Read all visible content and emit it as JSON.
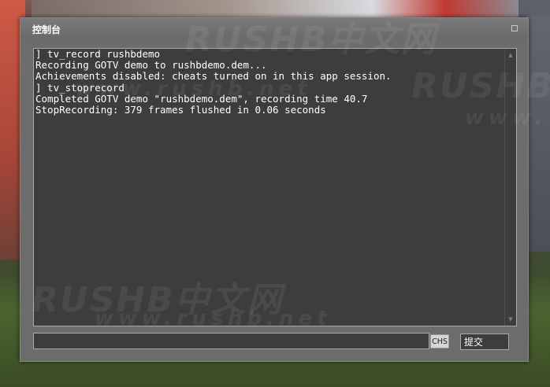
{
  "window": {
    "title": "控制台"
  },
  "console": {
    "lines": [
      "] tv_record rushbdemo",
      "Recording GOTV demo to rushbdemo.dem...",
      "Achievements disabled: cheats turned on in this app session.",
      "] tv_stoprecord",
      "Completed GOTV demo \"rushbdemo.dem\", recording time 40.7",
      "StopRecording: 379 frames flushed in 0.06 seconds"
    ]
  },
  "input": {
    "value": "",
    "language_indicator": "CHS",
    "submit_label": "提交"
  },
  "watermarks": {
    "logo_top": "RUSHB中文网",
    "url_top": "www.rushb.net",
    "logo_right": "RUSHB",
    "url_right": "www.",
    "logo_bottom": "RUSHB中文网",
    "url_bottom": "www.rushb.net"
  },
  "colors": {
    "panel_bg": "#6c6c6c",
    "text_area_bg": "#3d3d3d",
    "text_color": "#ffffff",
    "border": "#a9a9a9"
  }
}
